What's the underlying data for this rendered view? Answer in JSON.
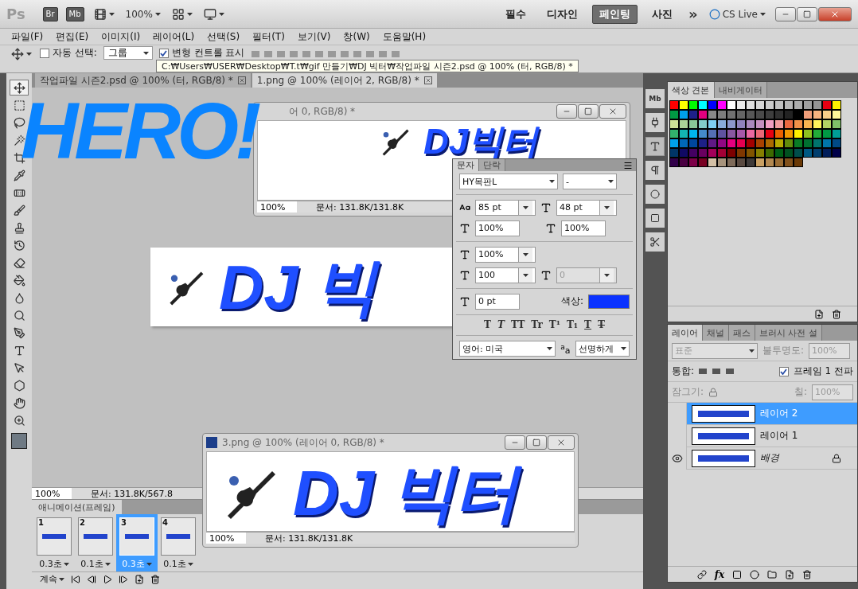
{
  "app_bar": {
    "logo": "Ps",
    "bridge": "Br",
    "mini_bridge": "Mb",
    "zoom": "100%",
    "workspaces": [
      {
        "label": "필수",
        "selected": false
      },
      {
        "label": "디자인",
        "selected": false
      },
      {
        "label": "페인팅",
        "selected": true
      },
      {
        "label": "사진",
        "selected": false
      }
    ],
    "more": "»",
    "cs_live": "CS Live"
  },
  "menu": [
    "파일(F)",
    "편집(E)",
    "이미지(I)",
    "레이어(L)",
    "선택(S)",
    "필터(T)",
    "보기(V)",
    "창(W)",
    "도움말(H)"
  ],
  "options_bar": {
    "auto_select": {
      "label": "자동 선택:",
      "checked": false
    },
    "auto_select_value": "그룹",
    "transform_controls": {
      "label": "변형 컨트롤 표시",
      "checked": true
    }
  },
  "tooltip": "C:₩Users₩USER₩Desktop₩T.t₩gif 만들기₩DJ 빅터₩작업파일 시즌2.psd @ 100% (터, RGB/8) *",
  "document_tabs": [
    {
      "label": "작업파일 시즌2.psd @ 100% (터, RGB/8) *",
      "selected": false
    },
    {
      "label": "1.png @ 100% (레이어 2, RGB/8) *",
      "selected": true
    }
  ],
  "overlay_text": "HERO!",
  "main_document": {
    "canvas_text": "DJ 빅",
    "zoom": "100%",
    "info": "문서: 131.8K/567.8"
  },
  "windows": [
    {
      "title": "어 0, RGB/8) *",
      "canvas_text": "DJ빅터",
      "zoom": "100%",
      "info": "문서: 131.8K/131.8K"
    },
    {
      "title": "3.png @ 100% (레이어 0, RGB/8) *",
      "canvas_text": "DJ 빅터",
      "zoom": "100%",
      "info": "문서: 131.8K/131.8K"
    }
  ],
  "character_panel": {
    "tabs": [
      {
        "label": "문자",
        "selected": true
      },
      {
        "label": "단락",
        "selected": false
      }
    ],
    "font": "HY목판L",
    "style": "-",
    "size": "85 pt",
    "leading": "48 pt",
    "vertical_scale": "100%",
    "horizontal_scale": "100%",
    "tsume": "100%",
    "tracking": "100",
    "kerning": "0",
    "baseline": "0 pt",
    "color_label": "색상:",
    "color": "#0a32ff",
    "style_buttons": [
      {
        "label": "T",
        "kind": "bold"
      },
      {
        "label": "T",
        "kind": "italic"
      },
      {
        "label": "TT",
        "kind": "caps"
      },
      {
        "label": "Tr",
        "kind": "smallcaps"
      },
      {
        "label": "T¹",
        "kind": "super"
      },
      {
        "label": "T₁",
        "kind": "sub"
      },
      {
        "label": "T",
        "kind": "underline"
      },
      {
        "label": "T",
        "kind": "strike"
      }
    ],
    "language": "영어: 미국",
    "aa_label": "$^{a}$a",
    "antialias": "선명하게"
  },
  "swatches_panel": {
    "tabs": [
      {
        "label": "색상 견본",
        "selected": true
      },
      {
        "label": "내비게이터",
        "selected": false
      }
    ],
    "swatch_rows": [
      {
        "swatches": [
          {
            "color": "#ff0000"
          },
          {
            "color": "#ffff00"
          },
          {
            "color": "#00ff00"
          },
          {
            "color": "#00ffff"
          },
          {
            "color": "#0000ff"
          },
          {
            "color": "#ff00ff"
          },
          {
            "color": "#ffffff"
          },
          {
            "color": "#ebebeb"
          },
          {
            "color": "#e1e1e1"
          },
          {
            "color": "#d7d7d7"
          },
          {
            "color": "#cccccc"
          },
          {
            "color": "#c2c2c2"
          },
          {
            "color": "#b7b7b7"
          },
          {
            "color": "#acacac"
          },
          {
            "color": "#a0a0a0"
          },
          {
            "color": "#959595"
          },
          {
            "color": "#e60012"
          },
          {
            "color": "#fff100"
          }
        ]
      },
      {
        "swatches": [
          {
            "color": "#009944"
          },
          {
            "color": "#00a0e9"
          },
          {
            "color": "#1d2088"
          },
          {
            "color": "#e4007f"
          },
          {
            "color": "#898989"
          },
          {
            "color": "#7d7d7d"
          },
          {
            "color": "#717171"
          },
          {
            "color": "#646464"
          },
          {
            "color": "#575757"
          },
          {
            "color": "#4a4a4a"
          },
          {
            "color": "#3e3e3e"
          },
          {
            "color": "#313131"
          },
          {
            "color": "#232323"
          },
          {
            "color": "#000000"
          },
          {
            "color": "#f19e7a"
          },
          {
            "color": "#f8b37f"
          },
          {
            "color": "#facd89"
          },
          {
            "color": "#fff799"
          }
        ]
      },
      {
        "swatches": [
          {
            "color": "#cce198"
          },
          {
            "color": "#acd598"
          },
          {
            "color": "#89c997"
          },
          {
            "color": "#84ccc9"
          },
          {
            "color": "#7ecef4"
          },
          {
            "color": "#88abda"
          },
          {
            "color": "#8c97cb"
          },
          {
            "color": "#8f82bc"
          },
          {
            "color": "#aa89bd"
          },
          {
            "color": "#c490bf"
          },
          {
            "color": "#f19ec2"
          },
          {
            "color": "#f29c9f"
          },
          {
            "color": "#eb6941"
          },
          {
            "color": "#f19149"
          },
          {
            "color": "#f8b551"
          },
          {
            "color": "#fff45c"
          },
          {
            "color": "#b3d465"
          },
          {
            "color": "#80c269"
          }
        ]
      },
      {
        "swatches": [
          {
            "color": "#32b16c"
          },
          {
            "color": "#13b5b1"
          },
          {
            "color": "#00b7ee"
          },
          {
            "color": "#448aca"
          },
          {
            "color": "#556fb5"
          },
          {
            "color": "#5f52a0"
          },
          {
            "color": "#8957a1"
          },
          {
            "color": "#a757a8"
          },
          {
            "color": "#ea68a2"
          },
          {
            "color": "#eb6877"
          },
          {
            "color": "#e60012"
          },
          {
            "color": "#eb6100"
          },
          {
            "color": "#f39800"
          },
          {
            "color": "#fff100"
          },
          {
            "color": "#8fc31f"
          },
          {
            "color": "#22ac38"
          },
          {
            "color": "#009944"
          },
          {
            "color": "#009e96"
          }
        ]
      },
      {
        "swatches": [
          {
            "color": "#00a0e9"
          },
          {
            "color": "#0068b7"
          },
          {
            "color": "#00479d"
          },
          {
            "color": "#1d2088"
          },
          {
            "color": "#601986"
          },
          {
            "color": "#920783"
          },
          {
            "color": "#e4007f"
          },
          {
            "color": "#e5004f"
          },
          {
            "color": "#a40000"
          },
          {
            "color": "#a84200"
          },
          {
            "color": "#ac6a00"
          },
          {
            "color": "#b7aa00"
          },
          {
            "color": "#638c0b"
          },
          {
            "color": "#097c25"
          },
          {
            "color": "#007130"
          },
          {
            "color": "#00736d"
          },
          {
            "color": "#0075a9"
          },
          {
            "color": "#004986"
          }
        ]
      },
      {
        "swatches": [
          {
            "color": "#003567"
          },
          {
            "color": "#100964"
          },
          {
            "color": "#440062"
          },
          {
            "color": "#6a005f"
          },
          {
            "color": "#a3005a"
          },
          {
            "color": "#a40035"
          },
          {
            "color": "#7d0000"
          },
          {
            "color": "#7e3700"
          },
          {
            "color": "#815400"
          },
          {
            "color": "#867f00"
          },
          {
            "color": "#3e6a00"
          },
          {
            "color": "#005e15"
          },
          {
            "color": "#005120"
          },
          {
            "color": "#004e4b"
          },
          {
            "color": "#005982"
          },
          {
            "color": "#003e6e"
          },
          {
            "color": "#001d5a"
          },
          {
            "color": "#000049"
          }
        ]
      },
      {
        "swatches": [
          {
            "color": "#31004a"
          },
          {
            "color": "#4a0042"
          },
          {
            "color": "#7d0048"
          },
          {
            "color": "#780022"
          },
          {
            "color": "#d3c0a6"
          },
          {
            "color": "#a6937c"
          },
          {
            "color": "#7e6b5a"
          },
          {
            "color": "#594a41"
          },
          {
            "color": "#3e3a39"
          },
          {
            "color": "#c9a063"
          },
          {
            "color": "#b28850"
          },
          {
            "color": "#996c33"
          },
          {
            "color": "#81511c"
          },
          {
            "color": "#6a3906"
          }
        ]
      }
    ]
  },
  "dock": {
    "mini_bridge": "Mb"
  },
  "layers_panel": {
    "fx_label": "fx",
    "tabs": [
      {
        "label": "레이어",
        "selected": true
      },
      {
        "label": "채널",
        "selected": false
      },
      {
        "label": "패스",
        "selected": false
      },
      {
        "label": "브러시 사전 설",
        "selected": false
      }
    ],
    "blend_mode": "표준",
    "opacity_label": "불투명도:",
    "opacity": "100%",
    "unify_label": "통합:",
    "propagate": {
      "label": "프레임 1 전파",
      "checked": true
    },
    "lock_label": "잠그기:",
    "fill_label": "칠:",
    "fill": "100%",
    "layers": [
      {
        "name": "레이어 2",
        "visible": false,
        "selected": true,
        "locked": false
      },
      {
        "name": "레이어 1",
        "visible": false,
        "selected": false,
        "locked": false
      },
      {
        "name": "배경",
        "visible": true,
        "selected": false,
        "locked": true
      }
    ]
  },
  "animation_panel": {
    "title": "애니메이션(프레임)",
    "frames": [
      {
        "number": "1",
        "delay": "0.3초",
        "selected": false
      },
      {
        "number": "2",
        "delay": "0.1초",
        "selected": false
      },
      {
        "number": "3",
        "delay": "0.3초",
        "selected": true
      },
      {
        "number": "4",
        "delay": "0.1초",
        "selected": false
      }
    ],
    "loop": "계속"
  }
}
